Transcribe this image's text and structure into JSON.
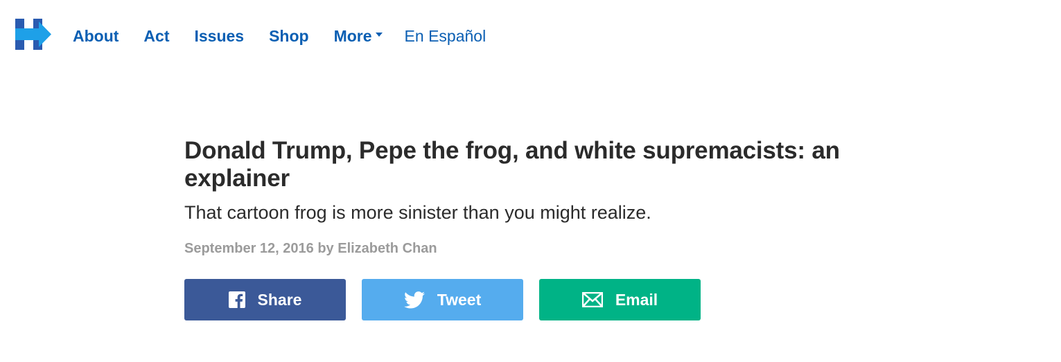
{
  "nav": {
    "logo_icon": "hillary-h-logo-icon",
    "links": [
      {
        "label": "About"
      },
      {
        "label": "Act"
      },
      {
        "label": "Issues"
      },
      {
        "label": "Shop"
      },
      {
        "label": "More",
        "has_dropdown": true
      }
    ],
    "language_link": "En Español",
    "colors": {
      "link": "#0b5fb3",
      "logo_blue": "#2a5bb0",
      "logo_red": "#e8223c",
      "logo_light": "#1ea0e8"
    }
  },
  "article": {
    "headline": "Donald Trump, Pepe the frog, and white supremacists: an explainer",
    "dek": "That cartoon frog is more sinister than you might realize.",
    "byline": "September 12, 2016 by Elizabeth Chan"
  },
  "share": {
    "facebook": {
      "label": "Share",
      "icon": "facebook-icon",
      "color": "#3b5998"
    },
    "twitter": {
      "label": "Tweet",
      "icon": "twitter-icon",
      "color": "#55acee"
    },
    "email": {
      "label": "Email",
      "icon": "envelope-icon",
      "color": "#00b386"
    }
  }
}
